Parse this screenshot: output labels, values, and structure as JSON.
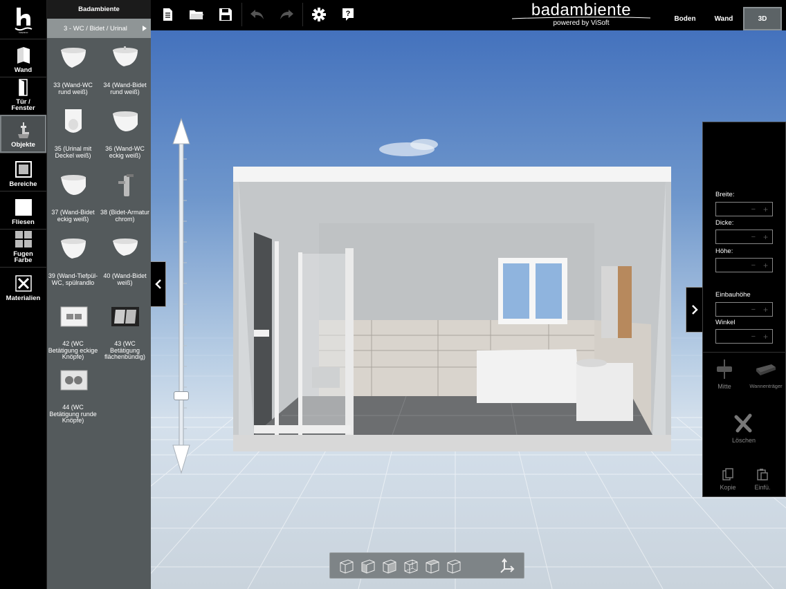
{
  "tools": [
    {
      "id": "wall",
      "label": "Wand",
      "icon": "wall-icon"
    },
    {
      "id": "door-window",
      "label": "Tür /\nFenster",
      "icon": "door-icon"
    },
    {
      "id": "objects",
      "label": "Objekte",
      "icon": "faucet-icon",
      "active": true
    },
    {
      "id": "areas",
      "label": "Bereiche",
      "icon": "area-icon"
    },
    {
      "id": "tiles",
      "label": "Fliesen",
      "icon": "tile-icon"
    },
    {
      "id": "grout",
      "label": "Fugen\nFarbe",
      "icon": "grout-icon"
    },
    {
      "id": "materials",
      "label": "Materialien",
      "icon": "materials-icon"
    }
  ],
  "library": {
    "title": "Badambiente",
    "category": "3 - WC / Bidet / Urinal",
    "items": [
      {
        "label": "33 (Wand-WC rund weiß)",
        "icon": "wall-wc-round-icon"
      },
      {
        "label": "34 (Wand-Bidet rund weiß)",
        "icon": "wall-bidet-round-icon"
      },
      {
        "label": "35 (Urinal mit Deckel weiß)",
        "icon": "urinal-icon"
      },
      {
        "label": "36 (Wand-WC eckig weiß)",
        "icon": "wall-wc-square-icon"
      },
      {
        "label": "37 (Wand-Bidet eckig weiß)",
        "icon": "wall-bidet-square-icon"
      },
      {
        "label": "38 (Bidet-Armatur chrom)",
        "icon": "bidet-faucet-icon"
      },
      {
        "label": "39 (Wand-Tiefpül-WC, spülrandlo",
        "icon": "wall-wc-rimless-icon"
      },
      {
        "label": "40 (Wand-Bidet weiß)",
        "icon": "wall-bidet-icon"
      },
      {
        "label": "42 (WC Betätigung eckige Knöpfe)",
        "icon": "flush-plate-square-icon"
      },
      {
        "label": "43 (WC Betätigung flächenbündig)",
        "icon": "flush-plate-flush-icon"
      },
      {
        "label": "44 (WC Betätigung runde Knöpfe)",
        "icon": "flush-plate-round-icon"
      }
    ]
  },
  "toolbar": {
    "buttons": [
      "new-document-icon",
      "open-folder-icon",
      "save-icon",
      "undo-icon",
      "redo-icon",
      "settings-gear-icon",
      "help-icon"
    ]
  },
  "brand": {
    "name": "badambiente",
    "subtitle": "powered by ViSoft"
  },
  "view_tabs": {
    "floor": "Boden",
    "wall": "Wand",
    "three_d": "3D"
  },
  "zoom": {
    "level": 0.15
  },
  "viewbar": {
    "buttons": [
      "cube-front-icon",
      "cube-left-icon",
      "cube-right-icon",
      "cube-back-icon",
      "cube-side-icon",
      "cube-iso-icon",
      "axes-icon"
    ]
  },
  "properties": {
    "width_label": "Breite:",
    "thickness_label": "Dicke:",
    "height_label": "Höhe:",
    "install_height_label": "Einbauhöhe",
    "angle_label": "Winkel",
    "minus": "−",
    "plus": "+",
    "center_label": "Mitte",
    "tub_support_label": "Wannenträger",
    "delete_label": "Löschen",
    "copy_label": "Kopie",
    "paste_label": "Einfü."
  },
  "colors": {
    "accent_panel": "#545a5c",
    "category_bar": "#8f9596",
    "active_tab": "#5c6366"
  }
}
